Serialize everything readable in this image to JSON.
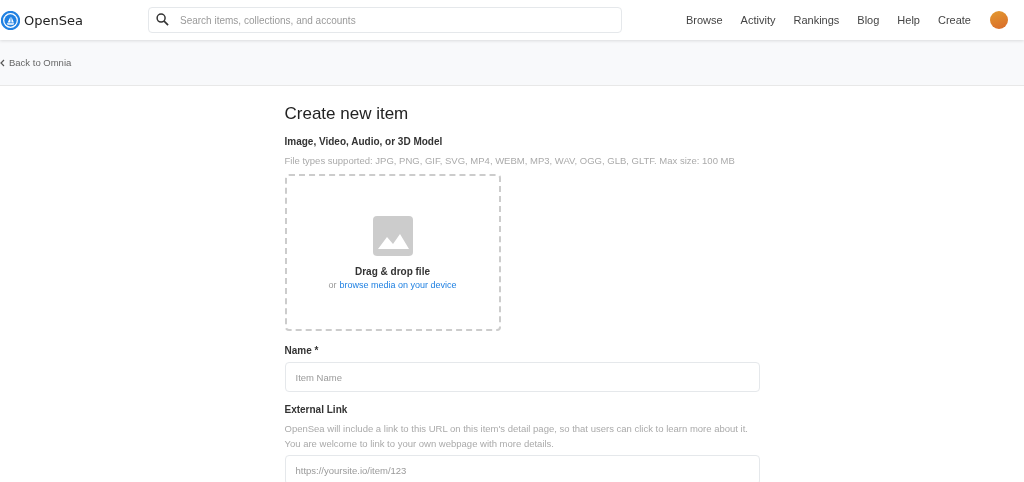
{
  "header": {
    "logo_text": "OpenSea",
    "search": {
      "placeholder": "Search items, collections, and accounts"
    },
    "nav": [
      {
        "label": "Browse"
      },
      {
        "label": "Activity"
      },
      {
        "label": "Rankings"
      },
      {
        "label": "Blog"
      },
      {
        "label": "Help"
      },
      {
        "label": "Create"
      }
    ]
  },
  "back_link": "Back to Omnia",
  "form": {
    "title": "Create new item",
    "media": {
      "label": "Image, Video, Audio, or 3D Model",
      "hint": "File types supported: JPG, PNG, GIF, SVG, MP4, WEBM, MP3, WAV, OGG, GLB, GLTF. Max size: 100 MB",
      "drop_title": "Drag & drop file",
      "drop_prefix": "or",
      "drop_link": "browse media on your device"
    },
    "fields": [
      {
        "label": "Name *",
        "placeholder": "Item Name"
      },
      {
        "label": "External Link",
        "description": "OpenSea will include a link to this URL on this item's detail page, so that users can click to learn more about it.\nYou are welcome to link to your own webpage with more details.",
        "placeholder": "https://yoursite.io/item/123"
      }
    ]
  }
}
